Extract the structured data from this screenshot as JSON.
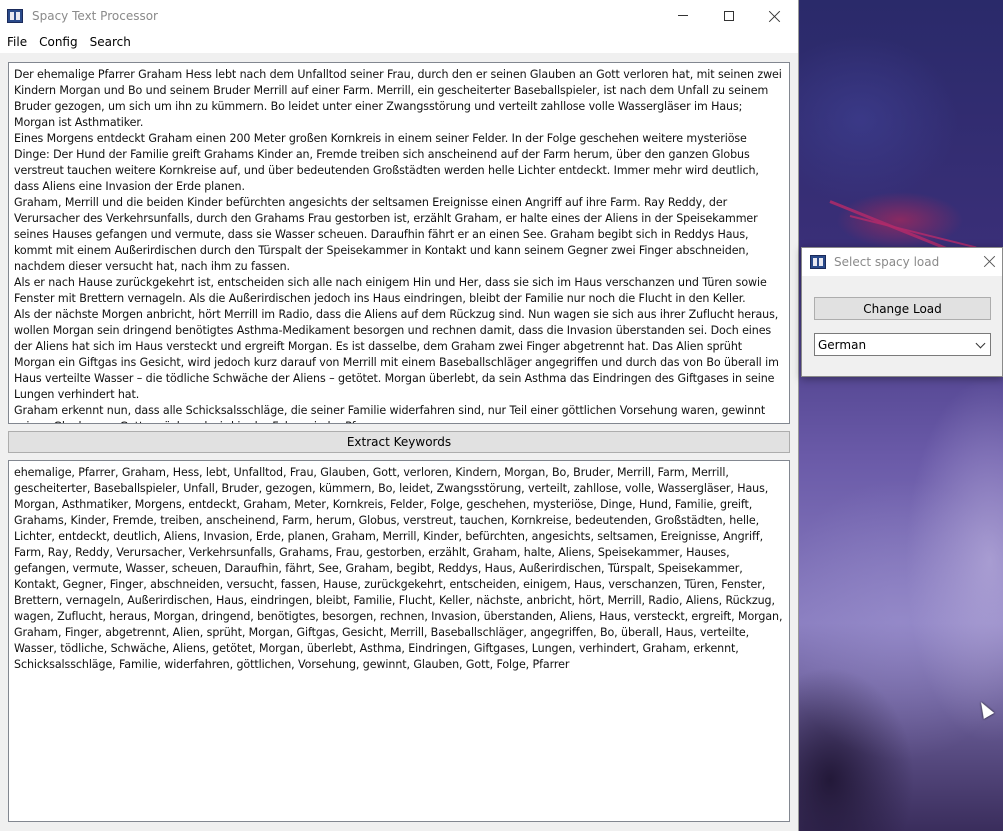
{
  "main_window": {
    "title": "Spacy Text Processor",
    "menu": [
      "File",
      "Config",
      "Search"
    ],
    "input_text": "Der ehemalige Pfarrer Graham Hess lebt nach dem Unfalltod seiner Frau, durch den er seinen Glauben an Gott verloren hat, mit seinen zwei Kindern Morgan und Bo und seinem Bruder Merrill auf einer Farm. Merrill, ein gescheiterter Baseballspieler, ist nach dem Unfall zu seinem Bruder gezogen, um sich um ihn zu kümmern. Bo leidet unter einer Zwangsstörung und verteilt zahllose volle Wassergläser im Haus; Morgan ist Asthmatiker.\nEines Morgens entdeckt Graham einen 200 Meter großen Kornkreis in einem seiner Felder. In der Folge geschehen weitere mysteriöse Dinge: Der Hund der Familie greift Grahams Kinder an, Fremde treiben sich anscheinend auf der Farm herum, über den ganzen Globus verstreut tauchen weitere Kornkreise auf, und über bedeutenden Großstädten werden helle Lichter entdeckt. Immer mehr wird deutlich, dass Aliens eine Invasion der Erde planen.\nGraham, Merrill und die beiden Kinder befürchten angesichts der seltsamen Ereignisse einen Angriff auf ihre Farm. Ray Reddy, der Verursacher des Verkehrsunfalls, durch den Grahams Frau gestorben ist, erzählt Graham, er halte eines der Aliens in der Speisekammer seines Hauses gefangen und vermute, dass sie Wasser scheuen. Daraufhin fährt er an einen See. Graham begibt sich in Reddys Haus, kommt mit einem Außerirdischen durch den Türspalt der Speisekammer in Kontakt und kann seinem Gegner zwei Finger abschneiden, nachdem dieser versucht hat, nach ihm zu fassen.\nAls er nach Hause zurückgekehrt ist, entscheiden sich alle nach einigem Hin und Her, dass sie sich im Haus verschanzen und Türen sowie Fenster mit Brettern vernageln. Als die Außerirdischen jedoch ins Haus eindringen, bleibt der Familie nur noch die Flucht in den Keller.\nAls der nächste Morgen anbricht, hört Merrill im Radio, dass die Aliens auf dem Rückzug sind. Nun wagen sie sich aus ihrer Zuflucht heraus, wollen Morgan sein dringend benötigtes Asthma-Medikament besorgen und rechnen damit, dass die Invasion überstanden sei. Doch eines der Aliens hat sich im Haus versteckt und ergreift Morgan. Es ist dasselbe, dem Graham zwei Finger abgetrennt hat. Das Alien sprüht Morgan ein Giftgas ins Gesicht, wird jedoch kurz darauf von Merrill mit einem Baseballschläger angegriffen und durch das von Bo überall im Haus verteilte Wasser – die tödliche Schwäche der Aliens – getötet. Morgan überlebt, da sein Asthma das Eindringen des Giftgases in seine Lungen verhindert hat.\nGraham erkennt nun, dass alle Schicksalsschläge, die seiner Familie widerfahren sind, nur Teil einer göttlichen Vorsehung waren, gewinnt seinen Glauben an Gott zurück und wird in der Folge wieder Pfarrer.",
    "extract_button": "Extract Keywords",
    "output_text": "ehemalige, Pfarrer, Graham, Hess, lebt, Unfalltod, Frau, Glauben, Gott, verloren, Kindern, Morgan, Bo, Bruder, Merrill, Farm, Merrill, gescheiterter, Baseballspieler, Unfall, Bruder, gezogen, kümmern, Bo, leidet, Zwangsstörung, verteilt, zahllose, volle, Wassergläser, Haus, Morgan, Asthmatiker, Morgens, entdeckt, Graham, Meter, Kornkreis, Felder, Folge, geschehen, mysteriöse, Dinge, Hund, Familie, greift, Grahams, Kinder, Fremde, treiben, anscheinend, Farm, herum, Globus, verstreut, tauchen, Kornkreise, bedeutenden, Großstädten, helle, Lichter, entdeckt, deutlich, Aliens, Invasion, Erde, planen, Graham, Merrill, Kinder, befürchten, angesichts, seltsamen, Ereignisse, Angriff, Farm, Ray, Reddy, Verursacher, Verkehrsunfalls, Grahams, Frau, gestorben, erzählt, Graham, halte, Aliens, Speisekammer, Hauses, gefangen, vermute, Wasser, scheuen, Daraufhin, fährt, See, Graham, begibt, Reddys, Haus, Außerirdischen, Türspalt, Speisekammer, Kontakt, Gegner, Finger, abschneiden, versucht, fassen, Hause, zurückgekehrt, entscheiden, einigem, Haus, verschanzen, Türen, Fenster, Brettern, vernageln, Außerirdischen, Haus, eindringen, bleibt, Familie, Flucht, Keller, nächste, anbricht, hört, Merrill, Radio, Aliens, Rückzug, wagen, Zuflucht, heraus, Morgan, dringend, benötigtes, besorgen, rechnen, Invasion, überstanden, Aliens, Haus, versteckt, ergreift, Morgan, Graham, Finger, abgetrennt, Alien, sprüht, Morgan, Giftgas, Gesicht, Merrill, Baseballschläger, angegriffen, Bo, überall, Haus, verteilte, Wasser, tödliche, Schwäche, Aliens, getötet, Morgan, überlebt, Asthma, Eindringen, Giftgases, Lungen, verhindert, Graham, erkennt, Schicksalsschläge, Familie, widerfahren, göttlichen, Vorsehung, gewinnt, Glauben, Gott, Folge, Pfarrer"
  },
  "dialog": {
    "title": "Select spacy load",
    "change_button": "Change Load",
    "language_selected": "German"
  },
  "icons": {
    "app": "book-icon",
    "minimize": "minimize-icon",
    "maximize": "maximize-icon",
    "close": "close-icon",
    "dropdown": "chevron-down-icon"
  }
}
